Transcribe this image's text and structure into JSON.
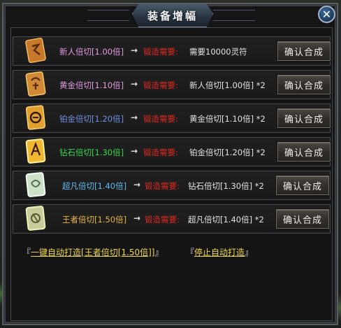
{
  "window": {
    "title": "装备增幅",
    "close_glyph": "✕"
  },
  "rows": [
    {
      "item_name": "新人倍切[1.00倍]",
      "name_color": "#e39be0",
      "arrow": "→",
      "req_label": "锻造需要:",
      "req_value": "需要10000灵符",
      "button": "确认合成",
      "icon": "amulet-bronze-icon"
    },
    {
      "item_name": "黄金倍切[1.10倍]",
      "name_color": "#e39be0",
      "arrow": "→",
      "req_label": "锻造需要:",
      "req_value": "新人倍切[1.00倍] *2",
      "button": "确认合成",
      "icon": "amulet-gold-icon"
    },
    {
      "item_name": "铂金倍切[1.20倍]",
      "name_color": "#6f8fe8",
      "arrow": "→",
      "req_label": "锻造需要:",
      "req_value": "黄金倍切[1.10倍] *2",
      "button": "确认合成",
      "icon": "amulet-platinum-icon"
    },
    {
      "item_name": "钻石倍切[1.30倍]",
      "name_color": "#34d84e",
      "arrow": "→",
      "req_label": "锻造需要:",
      "req_value": "铂金倍切[1.20倍] *2",
      "button": "确认合成",
      "icon": "amulet-diamond-icon"
    },
    {
      "item_name": "超凡倍切[1.40倍]",
      "name_color": "#5fb8f0",
      "arrow": "→",
      "req_label": "锻造需要:",
      "req_value": "钻石倍切[1.30倍] *2",
      "button": "确认合成",
      "icon": "amulet-transcend-icon"
    },
    {
      "item_name": "王者倍切[1.50倍]",
      "name_color": "#e7b33c",
      "arrow": "→",
      "req_label": "锻造需要:",
      "req_value": "超凡倍切[1.40倍] *2",
      "button": "确认合成",
      "icon": "amulet-king-icon"
    }
  ],
  "footer": {
    "auto_forge_open": "『",
    "auto_forge_link": "一键自动打造[王者倍切[1.50倍]]",
    "auto_forge_close": "』",
    "stop_open": "『",
    "stop_link": "停止自动打造",
    "stop_close": "』"
  }
}
